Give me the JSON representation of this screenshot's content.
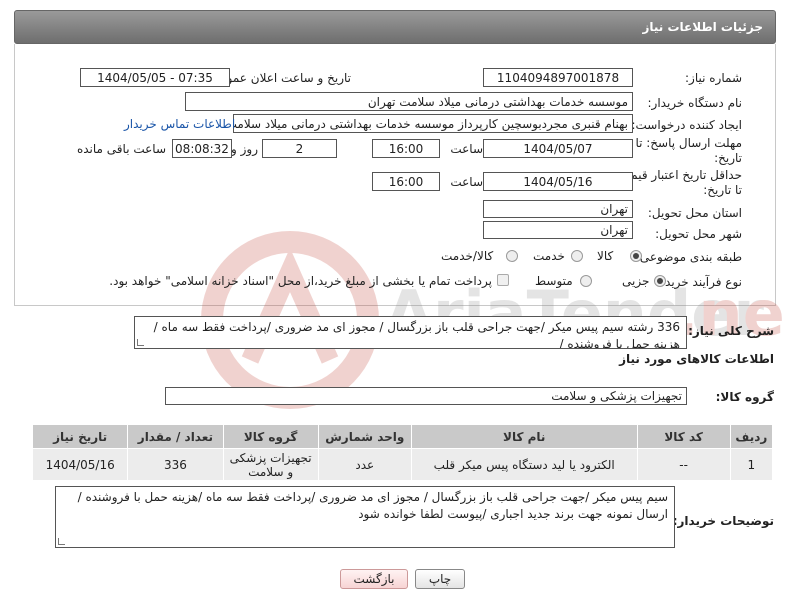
{
  "header": {
    "title": "جزئیات اطلاعات نیاز"
  },
  "form": {
    "need_number": {
      "label": "شماره نیاز:",
      "value": "1104094897001878"
    },
    "announce_date": {
      "label": "تاریخ و ساعت اعلان عمومی:",
      "value": "1404/05/05 - 07:35"
    },
    "buyer_org": {
      "label": "نام دستگاه خریدار:",
      "value": "موسسه خدمات بهداشتی درمانی میلاد سلامت تهران"
    },
    "requester": {
      "label": "ایجاد کننده درخواست:",
      "value": "بهنام قنبری مجردبوسچین کارپرداز موسسه خدمات بهداشتی درمانی میلاد سلامت تهران",
      "contact_link": "اطلاعات تماس خریدار"
    },
    "reply_deadline": {
      "label_line1": "مهلت ارسال پاسخ: تا",
      "label_line2": "تاریخ:",
      "date": "1404/05/07",
      "time_label": "ساعت",
      "time": "16:00",
      "days": "2",
      "days_label": "روز و",
      "remaining": "08:08:32",
      "remaining_label": "ساعت باقی مانده"
    },
    "price_validity": {
      "label_line1": "حداقل تاریخ اعتبار قیمت:",
      "label_line2": "تا تاریخ:",
      "date": "1404/05/16",
      "time_label": "ساعت",
      "time": "16:00"
    },
    "delivery_province": {
      "label": "استان محل تحویل:",
      "value": "تهران"
    },
    "delivery_city": {
      "label": "شهر محل تحویل:",
      "value": "تهران"
    },
    "category": {
      "label": "طبقه بندی موضوعی:",
      "options": [
        "کالا",
        "خدمت",
        "کالا/خدمت"
      ],
      "selected": 0
    },
    "purchase_type": {
      "label": "نوع فرآیند خرید :",
      "options": [
        "جزیی",
        "متوسط"
      ],
      "selected": 0,
      "payment_note": "پرداخت تمام یا بخشی از مبلغ خرید،از محل \"اسناد خزانه اسلامی\" خواهد بود."
    },
    "description": {
      "label": "شرح کلی نیاز:",
      "value": "336 رشته سیم پیس میکر /جهت جراحی قلب  باز بزرگسال / مجوز ای مد ضروری /پرداخت فقط سه ماه / هزینه حمل با فروشنده /"
    }
  },
  "goods": {
    "section_title": "اطلاعات کالاهای مورد نیاز",
    "group_label": "گروه کالا:",
    "group_value": "تجهیزات پزشکی و سلامت",
    "columns": [
      "ردیف",
      "کد کالا",
      "نام کالا",
      "واحد شمارش",
      "گروه کالا",
      "تعداد / مقدار",
      "تاریخ نیاز"
    ],
    "rows": [
      [
        "1",
        "--",
        "الکترود یا لید دستگاه پیس میکر قلب",
        "عدد",
        "تجهیزات پزشکی و سلامت",
        "336",
        "1404/05/16"
      ]
    ]
  },
  "buyer_notes": {
    "label": "توضیحات خریدار:",
    "value": "سیم پیس میکر /جهت جراحی قلب  باز بزرگسال / مجوز ای مد ضروری /پرداخت فقط سه ماه /هزینه حمل با فروشنده / ارسال نمونه جهت برند جدید اجباری /پیوست لطفا خوانده شود"
  },
  "buttons": {
    "print": "چاپ",
    "back": "بازگشت"
  },
  "colors": {
    "header_bg": "#7d7d7d",
    "table_header": "#c9c9c9",
    "link": "#1a55a8",
    "back_button": "#f7d4d4"
  }
}
